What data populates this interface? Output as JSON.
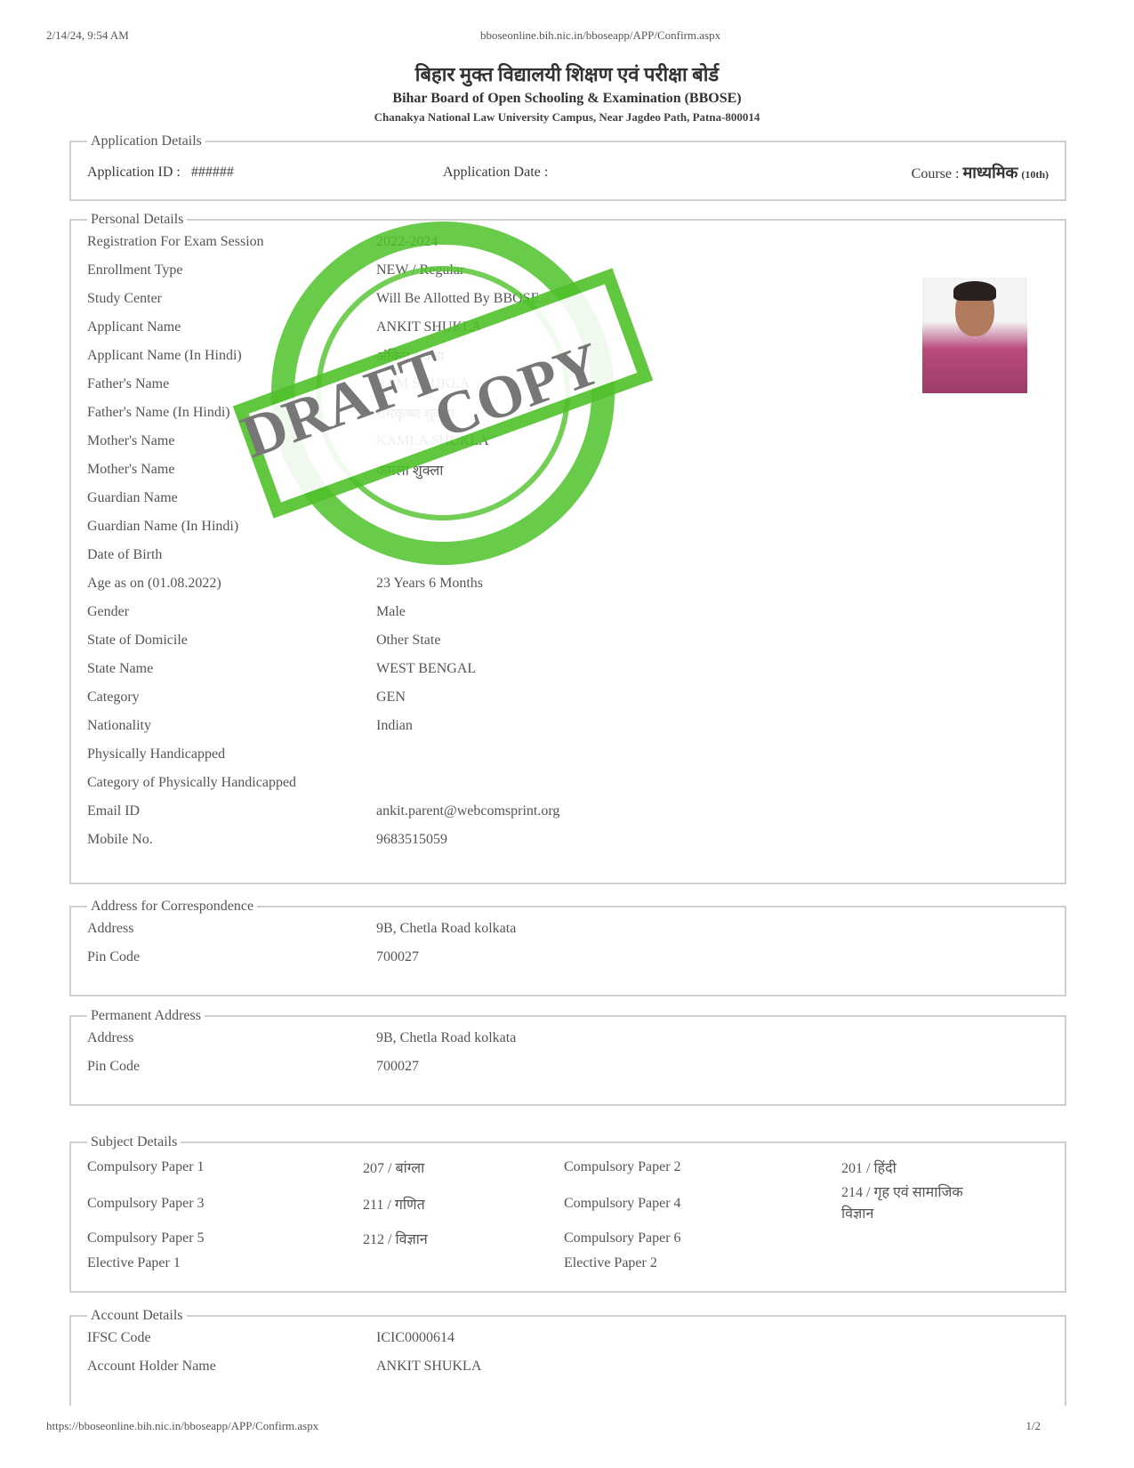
{
  "print_header": {
    "datetime": "2/14/24, 9:54 AM",
    "url": "bboseonline.bih.nic.in/bboseapp/APP/Confirm.aspx"
  },
  "board": {
    "title_hindi": "बिहार मुक्त विद्यालयी शिक्षण एवं परीक्षा बोर्ड",
    "title_english": "Bihar Board of Open Schooling & Examination (BBOSE)",
    "address": "Chanakya National Law University Campus, Near Jagdeo Path, Patna-800014"
  },
  "application": {
    "legend": "Application Details",
    "id_label": "Application ID :",
    "id_value": "######",
    "date_label": "Application Date :",
    "course_label": "Course :",
    "course_value": "माध्यमिक",
    "course_code": "(10th)"
  },
  "personal": {
    "legend": "Personal Details",
    "rows": [
      {
        "label": "Registration For Exam Session",
        "value": "2022-2024"
      },
      {
        "label": "Enrollment Type",
        "value": "NEW / Regular"
      },
      {
        "label": "Study Center",
        "value": "Will Be Allotted By BBOSE"
      },
      {
        "label": "Applicant Name",
        "value": "ANKIT SHUKLA"
      },
      {
        "label": "Applicant Name (In Hindi)",
        "value": "अंकित शुक्ला"
      },
      {
        "label": "Father's Name",
        "value": "RAM SHUKLA"
      },
      {
        "label": "Father's Name (In Hindi)",
        "value": "रामकृष्ण शुक्ला"
      },
      {
        "label": "Mother's Name",
        "value": "KAMLA SHUKLA"
      },
      {
        "label": "Mother's Name",
        "value": "कमला शुक्ला"
      },
      {
        "label": "Guardian Name",
        "value": ""
      },
      {
        "label": "Guardian Name (In Hindi)",
        "value": ""
      },
      {
        "label": "Date of Birth",
        "value": ""
      },
      {
        "label": "Age as on (01.08.2022)",
        "value": "23 Years 6 Months"
      },
      {
        "label": "Gender",
        "value": "Male"
      },
      {
        "label": "State of Domicile",
        "value": "Other State"
      },
      {
        "label": "State Name",
        "value": "WEST BENGAL"
      },
      {
        "label": "Category",
        "value": "GEN"
      },
      {
        "label": "Nationality",
        "value": "Indian"
      },
      {
        "label": "Physically Handicapped",
        "value": ""
      },
      {
        "label": "Category of Physically Handicapped",
        "value": ""
      },
      {
        "label": "Email ID",
        "value": "ankit.parent@webcomsprint.org"
      },
      {
        "label": "Mobile No.",
        "value": "9683515059"
      }
    ]
  },
  "correspondence": {
    "legend": "Address for Correspondence",
    "rows": [
      {
        "label": "Address",
        "value": "9B, Chetla Road kolkata"
      },
      {
        "label": "Pin Code",
        "value": "700027"
      }
    ]
  },
  "permanent": {
    "legend": "Permanent Address",
    "rows": [
      {
        "label": "Address",
        "value": "9B, Chetla Road kolkata"
      },
      {
        "label": "Pin Code",
        "value": "700027"
      }
    ]
  },
  "subjects": {
    "legend": "Subject Details",
    "p1_label": "Compulsory Paper 1",
    "p1_value": "207 / बांग्ला",
    "p2_label": "Compulsory Paper 2",
    "p2_value": "201 / हिंदी",
    "p3_label": "Compulsory Paper 3",
    "p3_value": "211 / गणित",
    "p4_label": "Compulsory Paper 4",
    "p4_value": "214 / गृह एवं सामाजिक विज्ञान",
    "p5_label": "Compulsory Paper 5",
    "p5_value": "212 / विज्ञान",
    "p6_label": "Compulsory Paper 6",
    "e1_label": "Elective Paper 1",
    "e2_label": "Elective Paper 2"
  },
  "account": {
    "legend": "Account Details",
    "rows": [
      {
        "label": "IFSC Code",
        "value": "ICIC0000614"
      },
      {
        "label": "Account Holder Name",
        "value": "ANKIT SHUKLA"
      }
    ]
  },
  "stamp": {
    "line1": "DRAFT",
    "line2": "COPY",
    "color": "#4fc22a"
  },
  "print_footer": {
    "url": "https://bboseonline.bih.nic.in/bboseapp/APP/Confirm.aspx",
    "page": "1/2"
  }
}
